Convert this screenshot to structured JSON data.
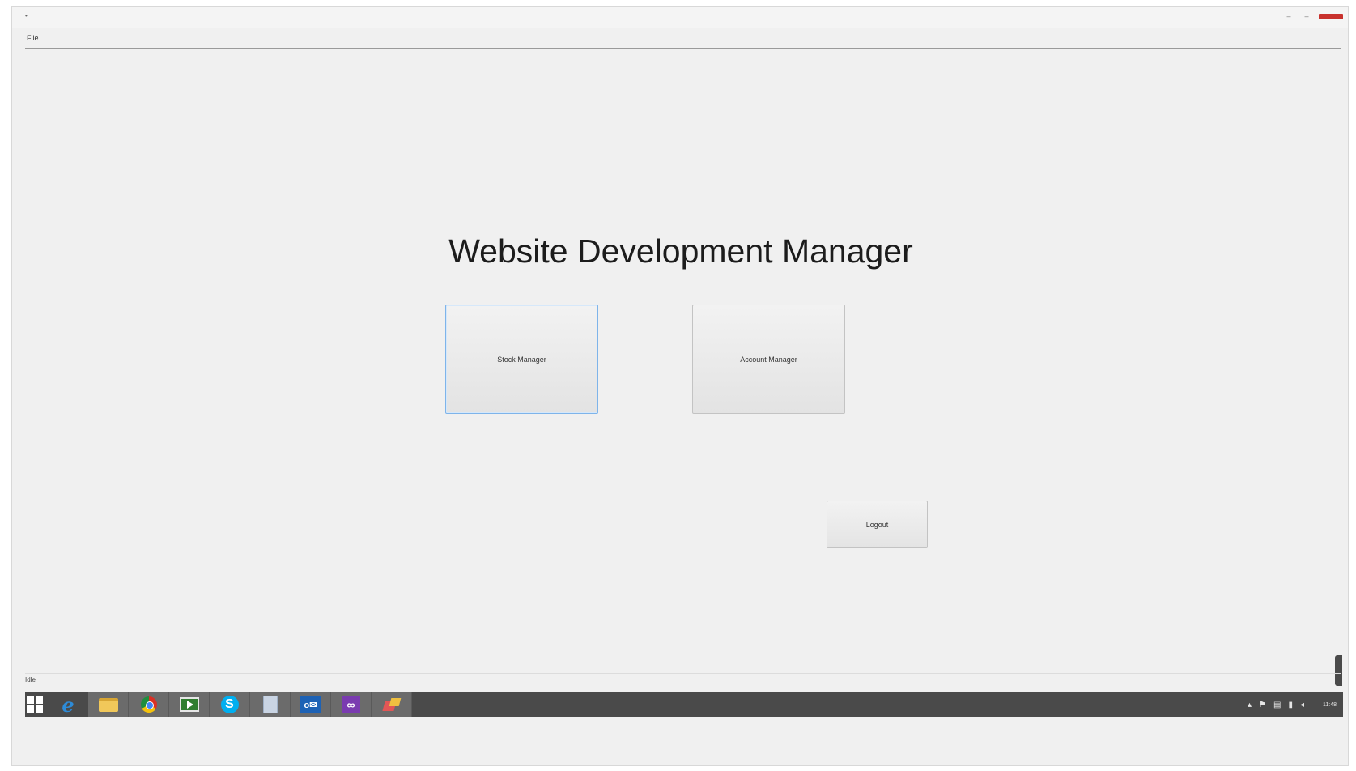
{
  "window": {
    "icon_glyph": "•",
    "title": "",
    "controls": {
      "minimize": "–",
      "maximize": "–"
    }
  },
  "menu": {
    "file": "File"
  },
  "main": {
    "heading": "Website Development Manager",
    "stock_manager_label": "Stock Manager",
    "account_manager_label": "Account Manager",
    "logout_label": "Logout"
  },
  "statusbar": {
    "label": "Idle"
  },
  "taskbar": {
    "apps": [
      {
        "icon": "internet-explorer-icon",
        "glyph": "e"
      },
      {
        "icon": "file-explorer-icon"
      },
      {
        "icon": "chrome-icon"
      },
      {
        "icon": "media-player-icon"
      },
      {
        "icon": "skype-icon",
        "glyph": "S"
      },
      {
        "icon": "document-icon"
      },
      {
        "icon": "outlook-icon",
        "glyph": "o✉"
      },
      {
        "icon": "visual-studio-icon",
        "glyph": "∞"
      },
      {
        "icon": "paint-icon"
      }
    ],
    "tray": {
      "chevron": "▴",
      "flag": "⚑",
      "network": "▤",
      "signal": "▮",
      "volume": "◂",
      "time": "11:48",
      "date": ""
    }
  },
  "colors": {
    "window_bg": "#f0f0f0",
    "taskbar_bg": "#4a4a4a",
    "close_button": "#c8322d",
    "focus_border": "#7eb4ea"
  }
}
